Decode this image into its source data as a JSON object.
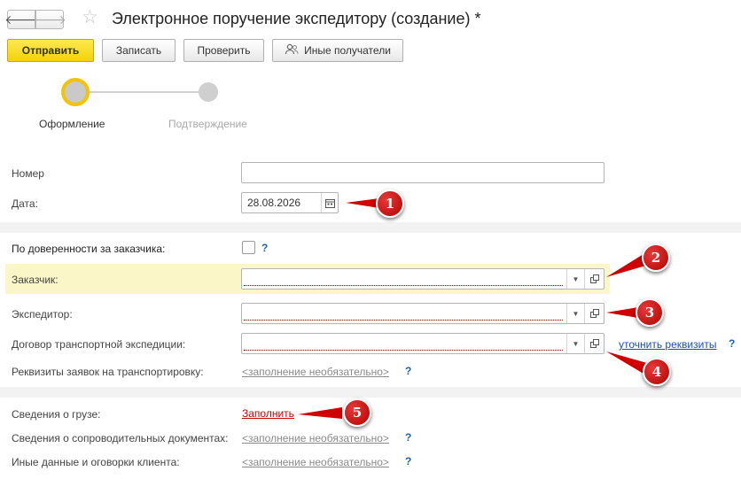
{
  "window": {
    "title": "Электронное поручение экспедитору (создание) *"
  },
  "toolbar": {
    "send_label": "Отправить",
    "save_label": "Записать",
    "check_label": "Проверить",
    "recipients_label": "Иные получатели"
  },
  "steps": [
    {
      "label": "Оформление",
      "state": "active"
    },
    {
      "label": "Подтверждение",
      "state": "inactive"
    }
  ],
  "form": {
    "number": {
      "label": "Номер",
      "value": ""
    },
    "date": {
      "label": "Дата:",
      "value": "28.08.2026"
    },
    "by_power_of_attorney": {
      "label": "По доверенности за заказчика:",
      "checked": false,
      "help": "?"
    },
    "customer": {
      "label": "Заказчик:",
      "value": ""
    },
    "forwarder": {
      "label": "Экспедитор:",
      "value": ""
    },
    "contract": {
      "label": "Договор транспортной экспедиции:",
      "value": "",
      "link": "уточнить реквизиты",
      "help": "?"
    },
    "transport_requisites": {
      "label": "Реквизиты заявок на транспортировку:",
      "link": "<заполнение необязательно>",
      "help": "?"
    },
    "cargo_info": {
      "label": "Сведения о грузе:",
      "link": "Заполнить"
    },
    "accompanying_docs": {
      "label": "Сведения о сопроводительных документах:",
      "link": "<заполнение необязательно>",
      "help": "?"
    },
    "other_data": {
      "label": "Иные данные и оговорки клиента:",
      "link": "<заполнение необязательно>",
      "help": "?"
    }
  },
  "annotations": [
    "1",
    "2",
    "3",
    "4",
    "5"
  ],
  "colors": {
    "primary_button": "#f2d20a",
    "step_active": "#f5c400",
    "highlight_row": "#fbf6c7",
    "annotation": "#d00000",
    "link_blue": "#1a4fb5"
  }
}
